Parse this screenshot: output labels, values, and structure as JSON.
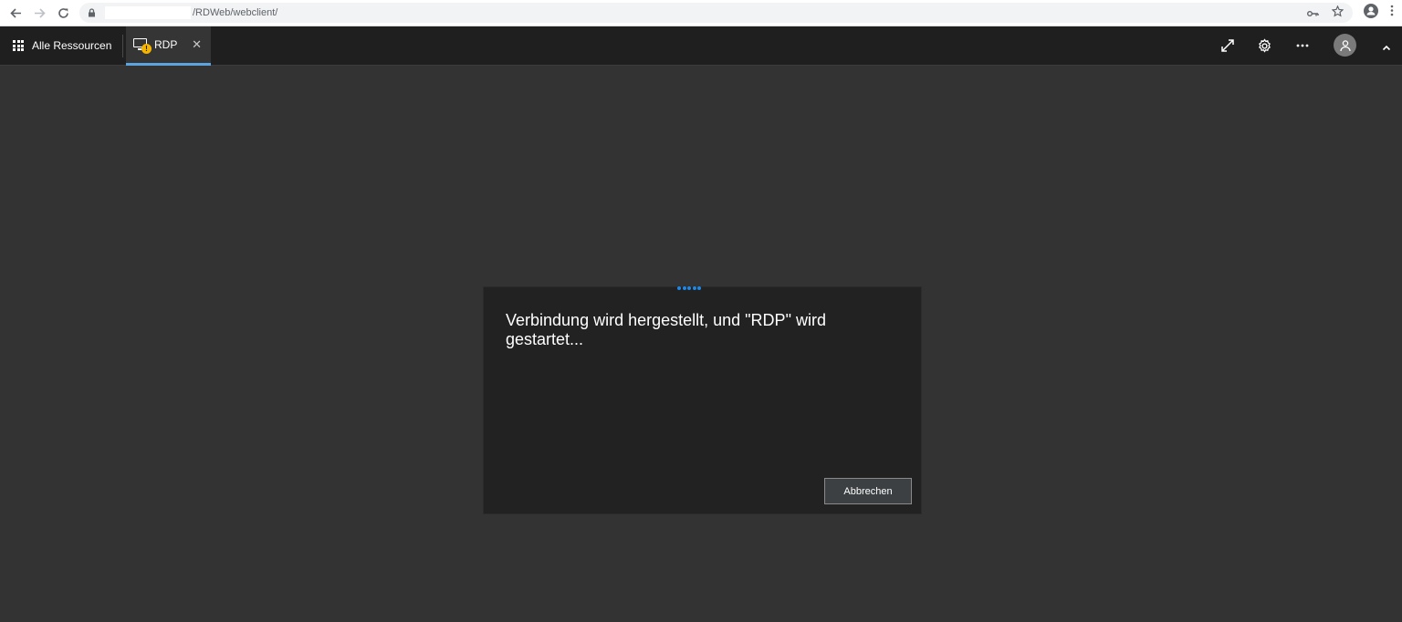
{
  "browser": {
    "url_path": "/RDWeb/webclient/"
  },
  "app_bar": {
    "all_resources_label": "Alle Ressourcen",
    "tab_label": "RDP",
    "tab_close": "✕",
    "warning_badge": "!"
  },
  "dialog": {
    "message": "Verbindung wird hergestellt, und \"RDP\" wird gestartet...",
    "cancel_label": "Abbrechen"
  },
  "colors": {
    "background": "#333333",
    "app_bar": "#1f1f1f",
    "dialog": "#222222",
    "accent": "#1e88e5",
    "tab_underline": "#5ba4e0",
    "warning": "#f4b400"
  },
  "icons": {
    "back": "arrow-left-icon",
    "forward": "arrow-right-icon",
    "reload": "reload-icon",
    "lock": "lock-icon",
    "key": "key-icon",
    "star": "star-icon",
    "profile": "profile-icon",
    "menu": "kebab-icon",
    "grid": "app-grid-icon",
    "monitor": "monitor-icon",
    "expand": "expand-icon",
    "settings": "gear-icon",
    "more": "more-icon",
    "avatar": "user-avatar-icon",
    "collapse": "chevron-up-icon"
  }
}
